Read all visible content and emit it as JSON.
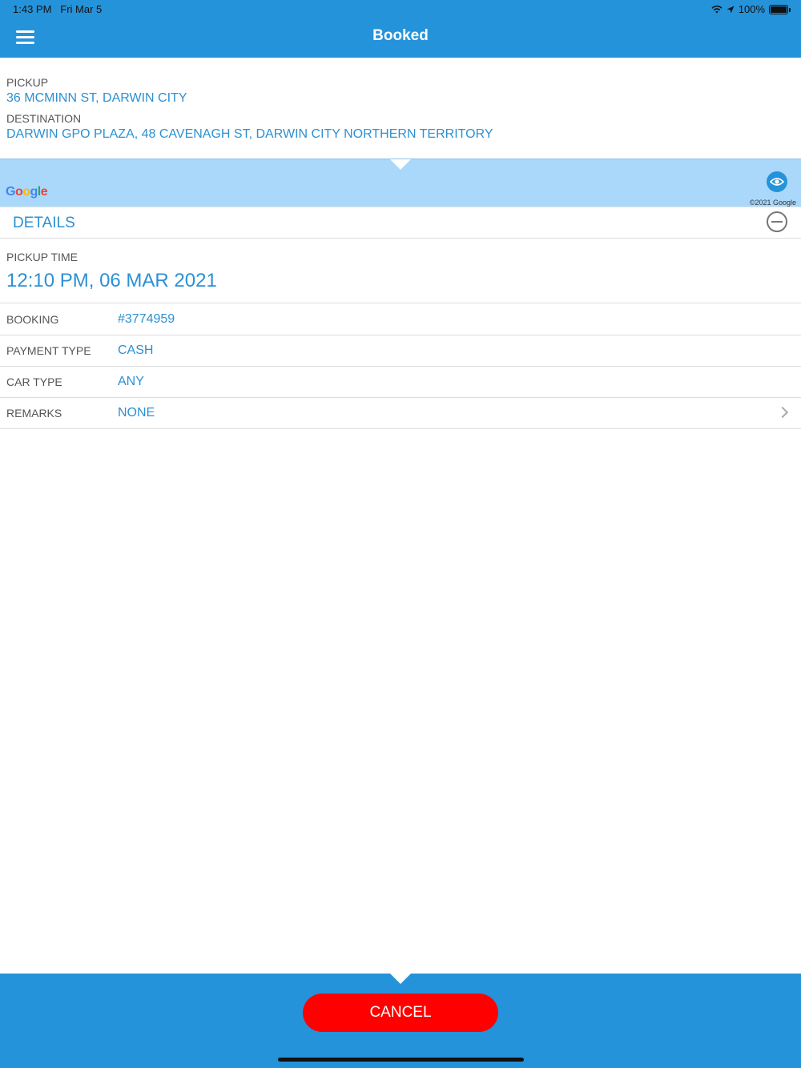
{
  "status_bar": {
    "time": "1:43 PM",
    "date": "Fri Mar 5",
    "battery": "100%"
  },
  "header": {
    "title": "Booked",
    "menu_icon": "hamburger-menu-icon"
  },
  "route": {
    "pickup_label": "PICKUP",
    "pickup_value": "36 MCMINN ST, DARWIN CITY",
    "destination_label": "DESTINATION",
    "destination_value": "DARWIN GPO PLAZA, 48 CAVENAGH ST, DARWIN CITY  NORTHERN TERRITORY"
  },
  "map": {
    "logo": "Google",
    "copyright": "©2021 Google",
    "eye_icon": "eye-icon"
  },
  "details": {
    "title": "DETAILS",
    "collapse_icon": "minus-circle-icon",
    "pickup_time_label": "PICKUP TIME",
    "pickup_time_value": "12:10 PM, 06 MAR 2021",
    "rows": [
      {
        "label": "BOOKING",
        "value": "#3774959"
      },
      {
        "label": "PAYMENT TYPE",
        "value": "CASH"
      },
      {
        "label": "CAR TYPE",
        "value": "ANY"
      },
      {
        "label": "REMARKS",
        "value": "NONE"
      }
    ]
  },
  "footer": {
    "cancel_label": "CANCEL"
  },
  "colors": {
    "primary": "#2593d9",
    "accent_text": "#2c90d3",
    "cancel": "#ff0000",
    "map": "#a9d8fb"
  }
}
